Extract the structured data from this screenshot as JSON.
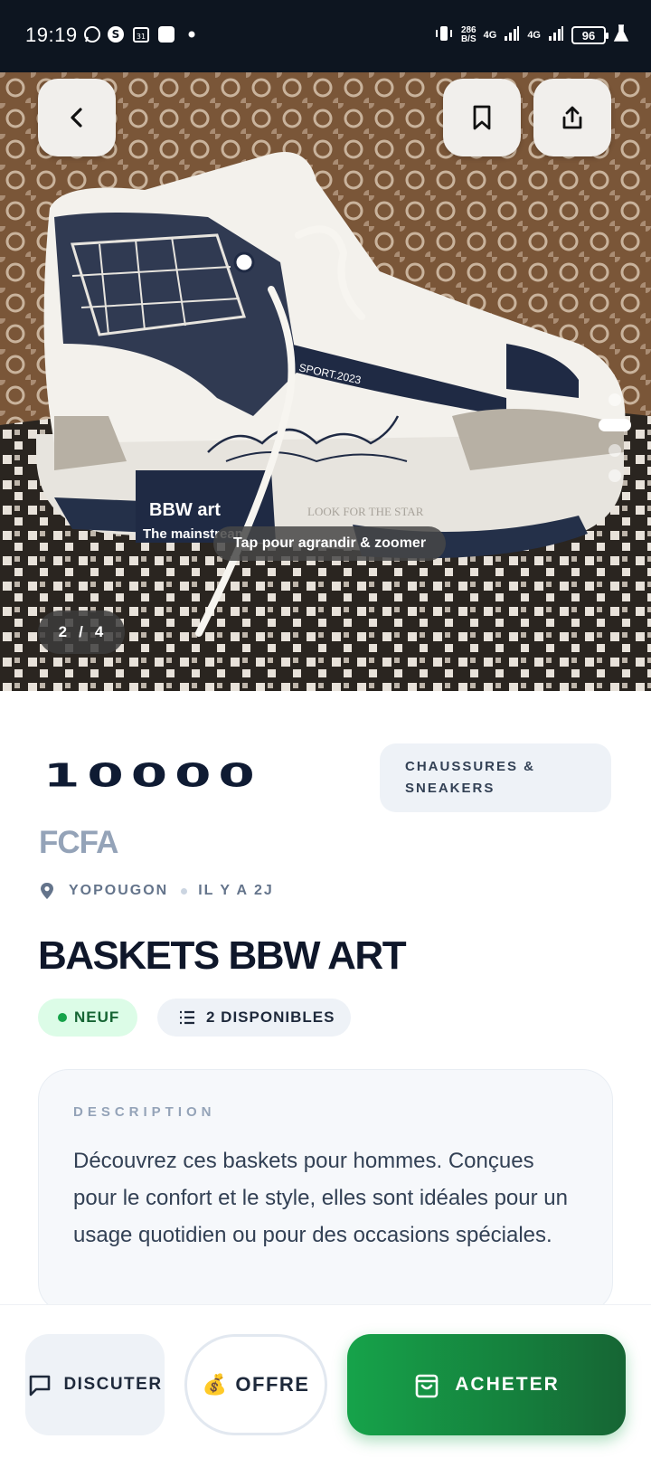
{
  "status_bar": {
    "time": "19:19",
    "net_speed_value": "286",
    "net_speed_unit": "B/S",
    "network_1": "4G",
    "network_2": "4G",
    "battery": "96"
  },
  "gallery": {
    "zoom_hint": "Tap pour agrandir & zoomer",
    "current_index": "2",
    "separator": "/",
    "total": "4",
    "print_text_1": "BBW art",
    "print_text_2": "The mainstream",
    "print_text_3": "SPORT.2023",
    "print_text_4": "LOOK FOR THE STAR",
    "slider_dots": 4,
    "active_dot": 2
  },
  "listing": {
    "price": "10000",
    "currency": "FCFA",
    "category_line1": "CHAUSSURES &",
    "category_line2": "SNEAKERS",
    "location": "YOPOUGON",
    "posted": "IL Y A 2J",
    "title": "BASKETS BBW ART",
    "condition": "NEUF",
    "stock": "2 DISPONIBLES",
    "description_label": "DESCRIPTION",
    "description": "Découvrez ces baskets pour hommes. Conçues pour le confort et le style, elles sont idéales pour un usage quotidien ou pour des occasions spéciales."
  },
  "actions": {
    "chat": "DISCUTER",
    "offer_emoji": "💰",
    "offer": "OFFRE",
    "buy": "ACHETER"
  },
  "colors": {
    "primary_green": "#16a34a",
    "dark_navy": "#0f1b33",
    "muted": "#94a3b8"
  }
}
